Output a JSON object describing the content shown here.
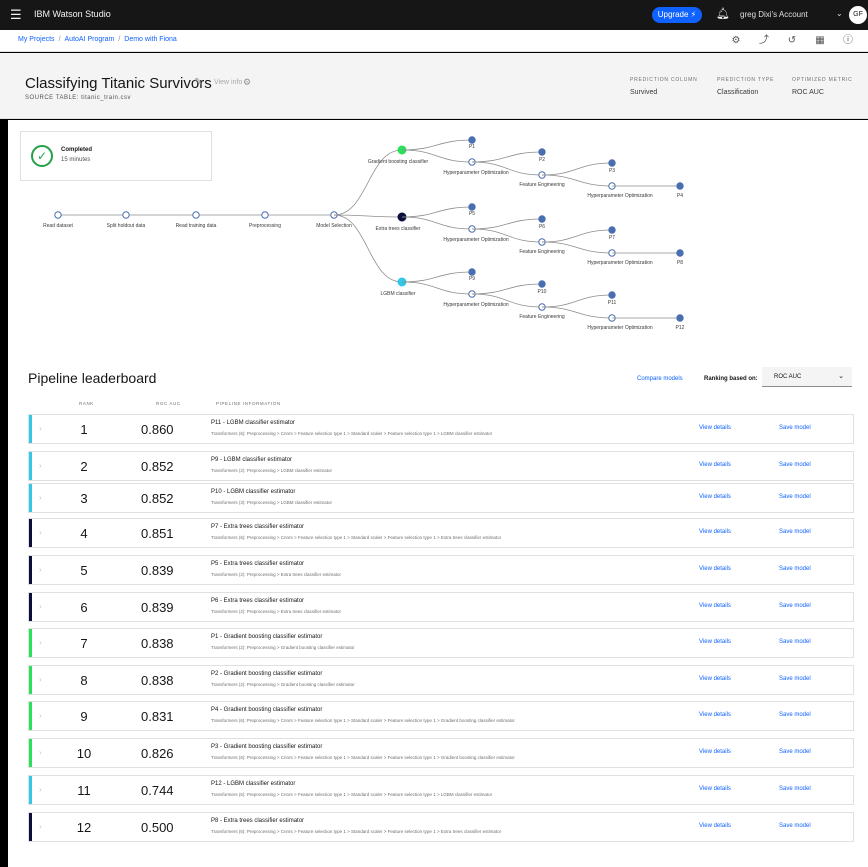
{
  "topbar": {
    "brand": "IBM Watson Studio",
    "upgrade_label": "Upgrade",
    "account": "greg Dixi's Account",
    "avatar": "GF"
  },
  "breadcrumb": {
    "items": [
      "My Projects",
      "AutoAI Program",
      "Demo with Fiona"
    ]
  },
  "header": {
    "title": "Classifying Titanic Survivors",
    "info_link": "View info",
    "source": "SOURCE TABLE: titanic_train.csv",
    "meta": [
      {
        "label": "PREDICTION COLUMN",
        "value": "Survived"
      },
      {
        "label": "PREDICTION TYPE",
        "value": "Classification"
      },
      {
        "label": "OPTIMIZED METRIC",
        "value": "ROC AUC"
      }
    ]
  },
  "status": {
    "title": "Completed",
    "subtitle": "15 minutes"
  },
  "tree": {
    "steps": [
      "Read dataset",
      "Split holdout data",
      "Read training data",
      "Preprocessing",
      "Model Selection"
    ],
    "algorithms": [
      "Gradient boosting classifier",
      "Extra trees classifier",
      "LGBM classifier"
    ],
    "hpo1": "Hyperparameter Optimization",
    "fe": "Feature Engineering",
    "hpo2": "Hyperparameter Optimization",
    "pipelines": [
      [
        "P1",
        "P2",
        "P3",
        "P4"
      ],
      [
        "P5",
        "P6",
        "P7",
        "P8"
      ],
      [
        "P9",
        "P10",
        "P11",
        "P12"
      ]
    ],
    "colors": {
      "gbc": "#2be05a",
      "etc": "#0b0f3c",
      "lgbm": "#33c7e8",
      "node": "#4a6fb0"
    }
  },
  "leaderboard": {
    "title": "Pipeline leaderboard",
    "compare_label": "Compare models",
    "rank_by_label": "Ranking based on:",
    "rank_by_value": "ROC AUC",
    "columns": [
      "RANK",
      "ROC AUC",
      "PIPELINE INFORMATION"
    ],
    "view_label": "View details",
    "save_label": "Save model",
    "rows": [
      {
        "rank": "1",
        "score": "0.860",
        "name": "P11 - LGBM classifier estimator",
        "desc": "Transformers (6): Preprocessing > Cnnrs > Feature selection type 1 > Standard scaler > Feature selection type 1 > LGBM classifier estimator",
        "color": "#33c7e8"
      },
      {
        "rank": "2",
        "score": "0.852",
        "name": "P9 - LGBM classifier estimator",
        "desc": "Transformers (2): Preprocessing > LGBM classifier estimator",
        "color": "#33c7e8"
      },
      {
        "rank": "3",
        "score": "0.852",
        "name": "P10 - LGBM classifier estimator",
        "desc": "Transformers (3): Preprocessing > LGBM classifier estimator",
        "color": "#33c7e8"
      },
      {
        "rank": "4",
        "score": "0.851",
        "name": "P7 - Extra trees classifier estimator",
        "desc": "Transformers (6): Preprocessing > Cnnrs > Feature selection type 1 > Standard scaler > Feature selection type 1 > Extra trees classifier estimator",
        "color": "#0b0f3c"
      },
      {
        "rank": "5",
        "score": "0.839",
        "name": "P5 - Extra trees classifier estimator",
        "desc": "Transformers (2): Preprocessing > Extra trees classifier estimator",
        "color": "#0b0f3c"
      },
      {
        "rank": "6",
        "score": "0.839",
        "name": "P6 - Extra trees classifier estimator",
        "desc": "Transformers (2): Preprocessing > Extra trees classifier estimator",
        "color": "#0b0f3c"
      },
      {
        "rank": "7",
        "score": "0.838",
        "name": "P1 - Gradient boosting classifier estimator",
        "desc": "Transformers (2): Preprocessing > Gradient boosting classifier estimator",
        "color": "#2be05a"
      },
      {
        "rank": "8",
        "score": "0.838",
        "name": "P2 - Gradient boosting classifier estimator",
        "desc": "Transformers (2): Preprocessing > Gradient boosting classifier estimator",
        "color": "#2be05a"
      },
      {
        "rank": "9",
        "score": "0.831",
        "name": "P4 - Gradient boosting classifier estimator",
        "desc": "Transformers (6): Preprocessing > Cnnrs > Feature selection type 1 > Standard scaler > Feature selection type 1 > Gradient boosting classifier estimator",
        "color": "#2be05a"
      },
      {
        "rank": "10",
        "score": "0.826",
        "name": "P3 - Gradient boosting classifier estimator",
        "desc": "Transformers (6): Preprocessing > Cnnrs > Feature selection type 1 > Standard scaler > Feature selection type 1 > Gradient boosting classifier estimator",
        "color": "#2be05a"
      },
      {
        "rank": "11",
        "score": "0.744",
        "name": "P12 - LGBM classifier estimator",
        "desc": "Transformers (6): Preprocessing > Cnnrs > Feature selection type 1 > Standard scaler > Feature selection type 1 > LGBM classifier estimator",
        "color": "#33c7e8"
      },
      {
        "rank": "12",
        "score": "0.500",
        "name": "P8 - Extra trees classifier estimator",
        "desc": "Transformers (6): Preprocessing > Cnnrs > Feature selection type 1 > Standard scaler > Feature selection type 1 > Extra trees classifier estimator",
        "color": "#0b0f3c"
      }
    ]
  }
}
